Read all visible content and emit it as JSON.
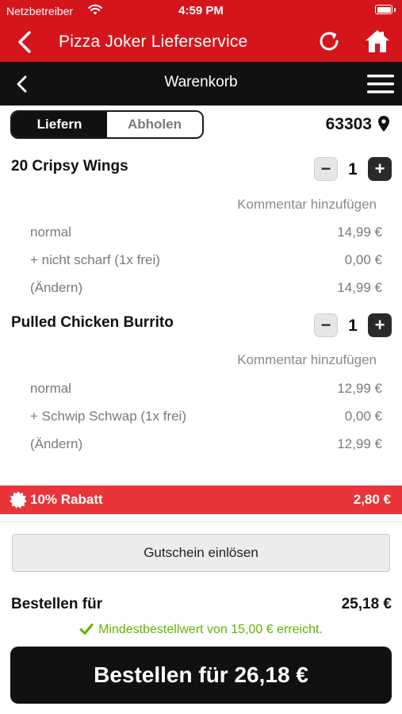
{
  "status": {
    "carrier": "Netzbetreiber",
    "time": "4:59 PM"
  },
  "app": {
    "title": "Pizza Joker Lieferservice"
  },
  "subnav": {
    "title": "Warenkorb"
  },
  "mode": {
    "deliver_label": "Liefern",
    "pickup_label": "Abholen",
    "selected": "Liefern"
  },
  "location": {
    "zip": "63303"
  },
  "cart": {
    "items": [
      {
        "name": "20 Cripsy Wings",
        "quantity": "1",
        "comment_label": "Kommentar hinzufügen",
        "lines": [
          {
            "label": "normal",
            "price": "14,99 €"
          },
          {
            "label": "+ nicht scharf (1x frei)",
            "price": "0,00 €"
          },
          {
            "label": "(Ändern)",
            "price": "14,99 €"
          }
        ]
      },
      {
        "name": "Pulled Chicken Burrito",
        "quantity": "1",
        "comment_label": "Kommentar hinzufügen",
        "lines": [
          {
            "label": "normal",
            "price": "12,99 €"
          },
          {
            "label": "+ Schwip Schwap (1x frei)",
            "price": "0,00 €"
          },
          {
            "label": "(Ändern)",
            "price": "12,99 €"
          }
        ]
      }
    ]
  },
  "discount": {
    "label": "10% Rabatt",
    "value": "2,80 €"
  },
  "voucher": {
    "label": "Gutschein einlösen"
  },
  "total": {
    "label": "Bestellen für",
    "value": "25,18 €"
  },
  "min_order": {
    "text": "Mindestbestellwert von 15,00 € erreicht."
  },
  "order_button": {
    "label": "Bestellen für 26,18 €"
  },
  "colors": {
    "brand_red": "#d4161c",
    "discount_red": "#e9353a",
    "dark": "#111111",
    "success_green": "#5fb400"
  }
}
